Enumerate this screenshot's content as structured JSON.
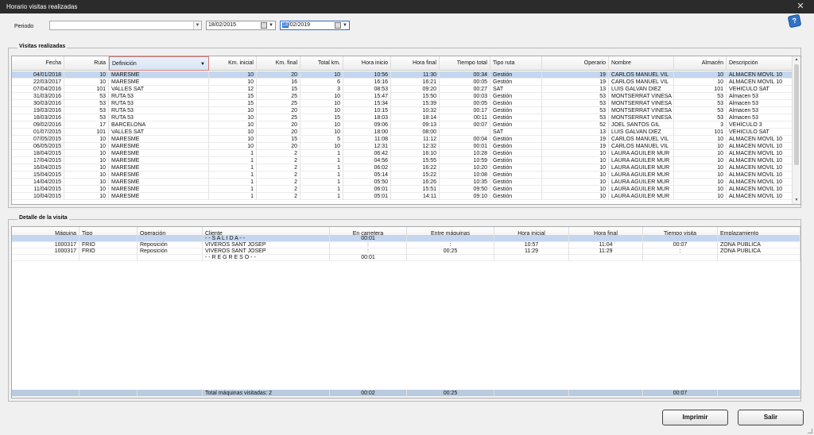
{
  "window": {
    "title": "Horario visitas realizadas",
    "close": "✕"
  },
  "filter": {
    "periodo_label": "Periodo",
    "periodo_value": "",
    "date_from": "18/02/2015",
    "date_to_sel": "18",
    "date_to_rest": "/02/2019",
    "help_icon": "?"
  },
  "visitas": {
    "title": "Visitas realizadas",
    "columns": [
      "Fecha",
      "Ruta",
      "Definición",
      "Km. inicial",
      "Km. final",
      "Total km.",
      "Hora inicio",
      "Hora final",
      "Tiempo total",
      "Tipo ruta",
      "Operario",
      "Nombre",
      "Almacén",
      "Descripción"
    ],
    "sort_indicator": "▼",
    "rows": [
      [
        "04/01/2018",
        "10",
        "MARESME",
        "10",
        "20",
        "10",
        "10:56",
        "11:30",
        "00:34",
        "Gestión",
        "19",
        "CARLOS  MANUEL VIL",
        "10",
        "ALMACEN MOVIL 10"
      ],
      [
        "22/03/2017",
        "10",
        "MARESME",
        "10",
        "16",
        "6",
        "16:16",
        "16:21",
        "00:05",
        "Gestión",
        "19",
        "CARLOS  MANUEL VIL",
        "10",
        "ALMACEN MOVIL 10"
      ],
      [
        "07/04/2016",
        "101",
        "VALLES SAT",
        "12",
        "15",
        "3",
        "08:53",
        "09:20",
        "00:27",
        "SAT",
        "13",
        "LUIS GALVAN DIEZ",
        "101",
        "VEHICULO SAT"
      ],
      [
        "31/03/2016",
        "53",
        "RUTA 53",
        "15",
        "25",
        "10",
        "15:47",
        "15:50",
        "00:03",
        "Gestión",
        "53",
        "MONTSERRAT VINESA",
        "53",
        "Almacen 53"
      ],
      [
        "30/03/2016",
        "53",
        "RUTA 53",
        "15",
        "25",
        "10",
        "15:34",
        "15:39",
        "00:05",
        "Gestión",
        "53",
        "MONTSERRAT VINESA",
        "53",
        "Almacen 53"
      ],
      [
        "19/03/2016",
        "53",
        "RUTA 53",
        "10",
        "20",
        "10",
        "10:15",
        "10:32",
        "00:17",
        "Gestión",
        "53",
        "MONTSERRAT VINESA",
        "53",
        "Almacen 53"
      ],
      [
        "18/03/2016",
        "53",
        "RUTA 53",
        "10",
        "25",
        "15",
        "18:03",
        "18:14",
        "00:11",
        "Gestión",
        "53",
        "MONTSERRAT VINESA",
        "53",
        "Almacen 53"
      ],
      [
        "09/02/2016",
        "17",
        "BARCELONA",
        "10",
        "20",
        "10",
        "09:06",
        "09:13",
        "00:07",
        "Gestión",
        "52",
        "JOEL SANTOS GIL",
        "3",
        "VEHÍCULO 3"
      ],
      [
        "01/07/2015",
        "101",
        "VALLES SAT",
        "10",
        "20",
        "10",
        "18:00",
        "08:00",
        "",
        "SAT",
        "13",
        "LUIS GALVAN DIEZ",
        "101",
        "VEHICULO SAT"
      ],
      [
        "07/05/2015",
        "10",
        "MARESME",
        "10",
        "15",
        "5",
        "11:08",
        "11:12",
        "00:04",
        "Gestión",
        "19",
        "CARLOS  MANUEL VIL",
        "10",
        "ALMACEN MOVIL 10"
      ],
      [
        "06/05/2015",
        "10",
        "MARESME",
        "10",
        "20",
        "10",
        "12:31",
        "12:32",
        "00:01",
        "Gestión",
        "19",
        "CARLOS  MANUEL VIL",
        "10",
        "ALMACEN MOVIL 10"
      ],
      [
        "18/04/2015",
        "10",
        "MARESME",
        "1",
        "2",
        "1",
        "06:42",
        "16:10",
        "10:28",
        "Gestión",
        "10",
        "LAURA AGUILER MUR",
        "10",
        "ALMACEN MOVIL 10"
      ],
      [
        "17/04/2015",
        "10",
        "MARESME",
        "1",
        "2",
        "1",
        "04:56",
        "15:55",
        "10:59",
        "Gestión",
        "10",
        "LAURA AGUILER MUR",
        "10",
        "ALMACEN MOVIL 10"
      ],
      [
        "16/04/2015",
        "10",
        "MARESME",
        "1",
        "2",
        "1",
        "06:02",
        "16:22",
        "10:20",
        "Gestión",
        "10",
        "LAURA AGUILER MUR",
        "10",
        "ALMACEN MOVIL 10"
      ],
      [
        "15/04/2015",
        "10",
        "MARESME",
        "1",
        "2",
        "1",
        "05:14",
        "15:22",
        "10:08",
        "Gestión",
        "10",
        "LAURA AGUILER MUR",
        "10",
        "ALMACEN MOVIL 10"
      ],
      [
        "14/04/2015",
        "10",
        "MARESME",
        "1",
        "2",
        "1",
        "05:50",
        "16:26",
        "10:35",
        "Gestión",
        "10",
        "LAURA AGUILER MUR",
        "10",
        "ALMACEN MOVIL 10"
      ],
      [
        "11/04/2015",
        "10",
        "MARESME",
        "1",
        "2",
        "1",
        "06:01",
        "15:51",
        "09:50",
        "Gestión",
        "10",
        "LAURA AGUILER MUR",
        "10",
        "ALMACEN MOVIL 10"
      ],
      [
        "10/04/2015",
        "10",
        "MARESME",
        "1",
        "2",
        "1",
        "05:01",
        "14:11",
        "09:10",
        "Gestión",
        "10",
        "LAURA AGUILER MUR",
        "10",
        "ALMACEN MOVIL 10"
      ]
    ]
  },
  "detalle": {
    "title": "Detalle de la visita",
    "columns": [
      "Máquina",
      "Tipo",
      "Operación",
      "Cliente",
      "En carretera",
      "Entre máquinas",
      "Hora inicial",
      "Hora final",
      "Tiempo visita",
      "Emplazamiento"
    ],
    "rows": [
      [
        "",
        "",
        "",
        "- - S A L I D A - -",
        "00:01",
        "",
        "",
        "",
        "",
        ""
      ],
      [
        "1000317",
        "FRIO",
        "Reposición",
        "VIVEROS SANT JOSEP",
        ":",
        ":",
        "10:57",
        "11:04",
        "00:07",
        "ZONA PUBLICA"
      ],
      [
        "1000317",
        "FRIO",
        "Reposición",
        "VIVEROS SANT JOSEP",
        ":",
        "00:25",
        "11:29",
        "11:29",
        ":",
        "ZONA PUBLICA"
      ],
      [
        "",
        "",
        "",
        "- - R E G R E S O - -",
        "00:01",
        "",
        "",
        "",
        "",
        ""
      ]
    ],
    "totals": [
      "",
      "",
      "",
      "Total máquinas visitadas: 2",
      "00:02",
      "00:25",
      "",
      "",
      "00:07",
      ""
    ]
  },
  "buttons": {
    "imprimir": "Imprimir",
    "salir": "Salir"
  }
}
